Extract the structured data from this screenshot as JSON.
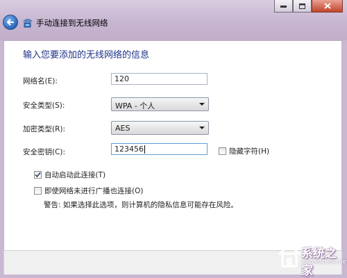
{
  "window": {
    "title": "手动连接到无线网络"
  },
  "page": {
    "heading": "输入您要添加的无线网络的信息"
  },
  "form": {
    "network_name": {
      "label": "网络名(E):",
      "value": "120"
    },
    "security_type": {
      "label": "安全类型(S):",
      "value": "WPA - 个人"
    },
    "encryption_type": {
      "label": "加密类型(R):",
      "value": "AES"
    },
    "security_key": {
      "label": "安全密钥(C):",
      "value": "123456"
    },
    "hide_chars": {
      "label": "隐藏字符(H)",
      "checked": false
    }
  },
  "options": {
    "auto_connect": {
      "label": "自动启动此连接(T)",
      "checked": true
    },
    "connect_hidden": {
      "label": "即使网络未进行广播也连接(O)",
      "checked": false
    },
    "warning": "警告: 如果选择此选项，则计算机的隐私信息可能存在风险。"
  },
  "watermark": {
    "name": "系统之家",
    "url": "XITONGZHIJIA.NET"
  },
  "icons": {
    "back": "back-arrow-icon",
    "network": "wireless-network-icon",
    "minimize": "minimize-icon",
    "maximize": "maximize-icon",
    "close": "close-icon",
    "checkmark": "checkmark-icon"
  }
}
